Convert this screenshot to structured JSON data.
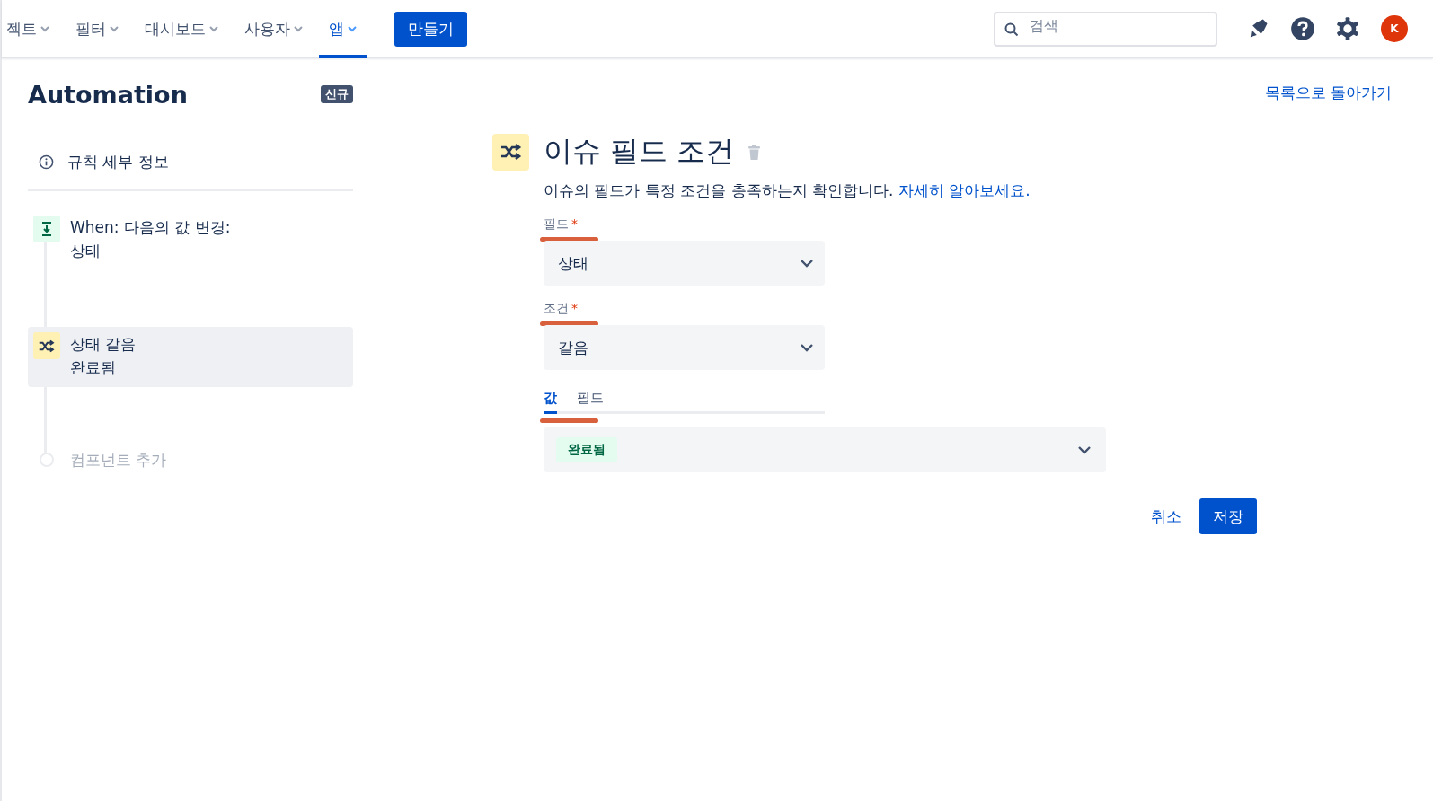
{
  "nav": {
    "items": [
      {
        "label": "젝트",
        "selected": false
      },
      {
        "label": "필터",
        "selected": false
      },
      {
        "label": "대시보드",
        "selected": false
      },
      {
        "label": "사용자",
        "selected": false
      },
      {
        "label": "앱",
        "selected": true
      }
    ],
    "create_button": "만들기",
    "search": {
      "placeholder": "검색"
    },
    "avatar": "K"
  },
  "sidebar": {
    "title": "Automation",
    "badge": "신규",
    "details": "규칙 세부 정보",
    "steps": [
      {
        "kind": "trigger",
        "title": "When: 다음의 값 변경:",
        "subtitle": "상태",
        "selected": false
      },
      {
        "kind": "condition",
        "title": "상태 같음",
        "subtitle": "완료됨",
        "selected": true
      },
      {
        "kind": "add",
        "title": "컴포넌트 추가"
      }
    ]
  },
  "back_link": "목록으로 돌아가기",
  "panel": {
    "title": "이슈 필드 조건",
    "description": "이슈의 필드가 특정 조건을 충족하는지 확인합니다.",
    "learn_more": "자세히 알아보세요.",
    "fields": [
      {
        "label": "필드",
        "required_mark": "*",
        "value": "상태"
      },
      {
        "label": "조건",
        "required_mark": "*",
        "value": "같음"
      }
    ],
    "tabs": [
      {
        "label": "값",
        "selected": true
      },
      {
        "label": "필드",
        "selected": false
      }
    ],
    "value_tag": "완료됨",
    "cancel": "취소",
    "save": "저장"
  }
}
